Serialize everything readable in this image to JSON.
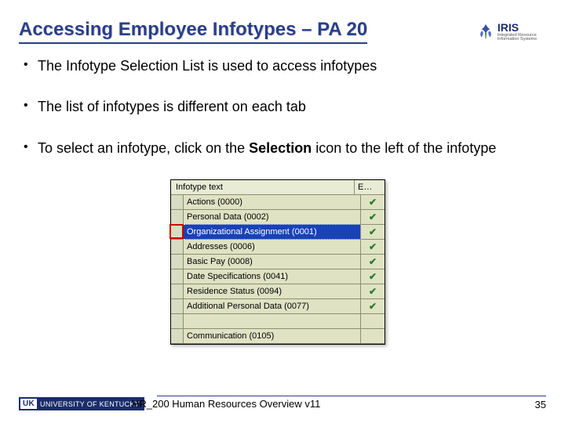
{
  "header": {
    "title": "Accessing Employee Infotypes – PA 20",
    "logo_text": "IRIS",
    "logo_sub1": "Integrated Resource",
    "logo_sub2": "Information Systems"
  },
  "bullets": [
    "The Infotype Selection List is used to access infotypes",
    "The list of infotypes is different on each tab",
    "To select an infotype, click on the Selection icon to the left of the infotype"
  ],
  "sap": {
    "col_text": "Infotype text",
    "col_e": "E…",
    "rows": [
      {
        "text": "Actions (0000)",
        "check": true,
        "selected": false
      },
      {
        "text": "Personal Data (0002)",
        "check": true,
        "selected": false
      },
      {
        "text": "Organizational Assignment (0001)",
        "check": true,
        "selected": true
      },
      {
        "text": "Addresses (0006)",
        "check": true,
        "selected": false
      },
      {
        "text": "Basic Pay (0008)",
        "check": true,
        "selected": false
      },
      {
        "text": "Date Specifications (0041)",
        "check": true,
        "selected": false
      },
      {
        "text": "Residence Status (0094)",
        "check": true,
        "selected": false
      },
      {
        "text": "Additional Personal Data (0077)",
        "check": true,
        "selected": false
      },
      {
        "text": "",
        "check": false,
        "selected": false
      },
      {
        "text": "Communication (0105)",
        "check": false,
        "selected": false
      }
    ]
  },
  "footer": {
    "uk_mark": "UK",
    "uk_text": "UNIVERSITY OF KENTUCKY",
    "course": "HR_200 Human Resources Overview v11",
    "page": "35"
  }
}
